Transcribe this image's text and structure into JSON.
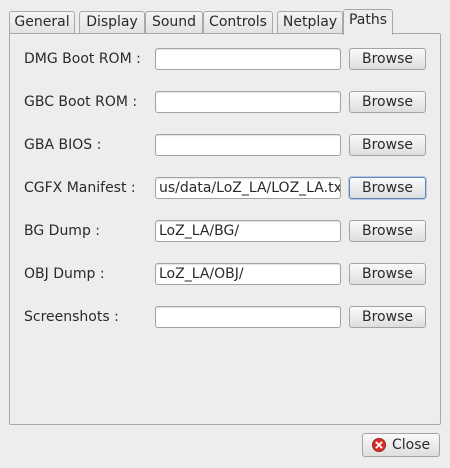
{
  "tabs": [
    {
      "label": "General"
    },
    {
      "label": "Display"
    },
    {
      "label": "Sound"
    },
    {
      "label": "Controls"
    },
    {
      "label": "Netplay"
    },
    {
      "label": "Paths",
      "active": true
    }
  ],
  "paths": {
    "dmg_boot_rom": {
      "label": "DMG Boot ROM :",
      "value": ""
    },
    "gbc_boot_rom": {
      "label": "GBC Boot ROM :",
      "value": ""
    },
    "gba_bios": {
      "label": "GBA BIOS :",
      "value": ""
    },
    "cgfx_manifest": {
      "label": "CGFX Manifest :",
      "value": "us/data/LoZ_LA/LOZ_LA.txt"
    },
    "bg_dump": {
      "label": "BG Dump :",
      "value": "LoZ_LA/BG/"
    },
    "obj_dump": {
      "label": "OBJ Dump :",
      "value": "LoZ_LA/OBJ/"
    },
    "screenshots": {
      "label": "Screenshots :",
      "value": ""
    },
    "browse_label": "Browse"
  },
  "footer": {
    "close_label": "Close",
    "close_icon": "close-icon",
    "close_icon_color": "#d6312b"
  }
}
